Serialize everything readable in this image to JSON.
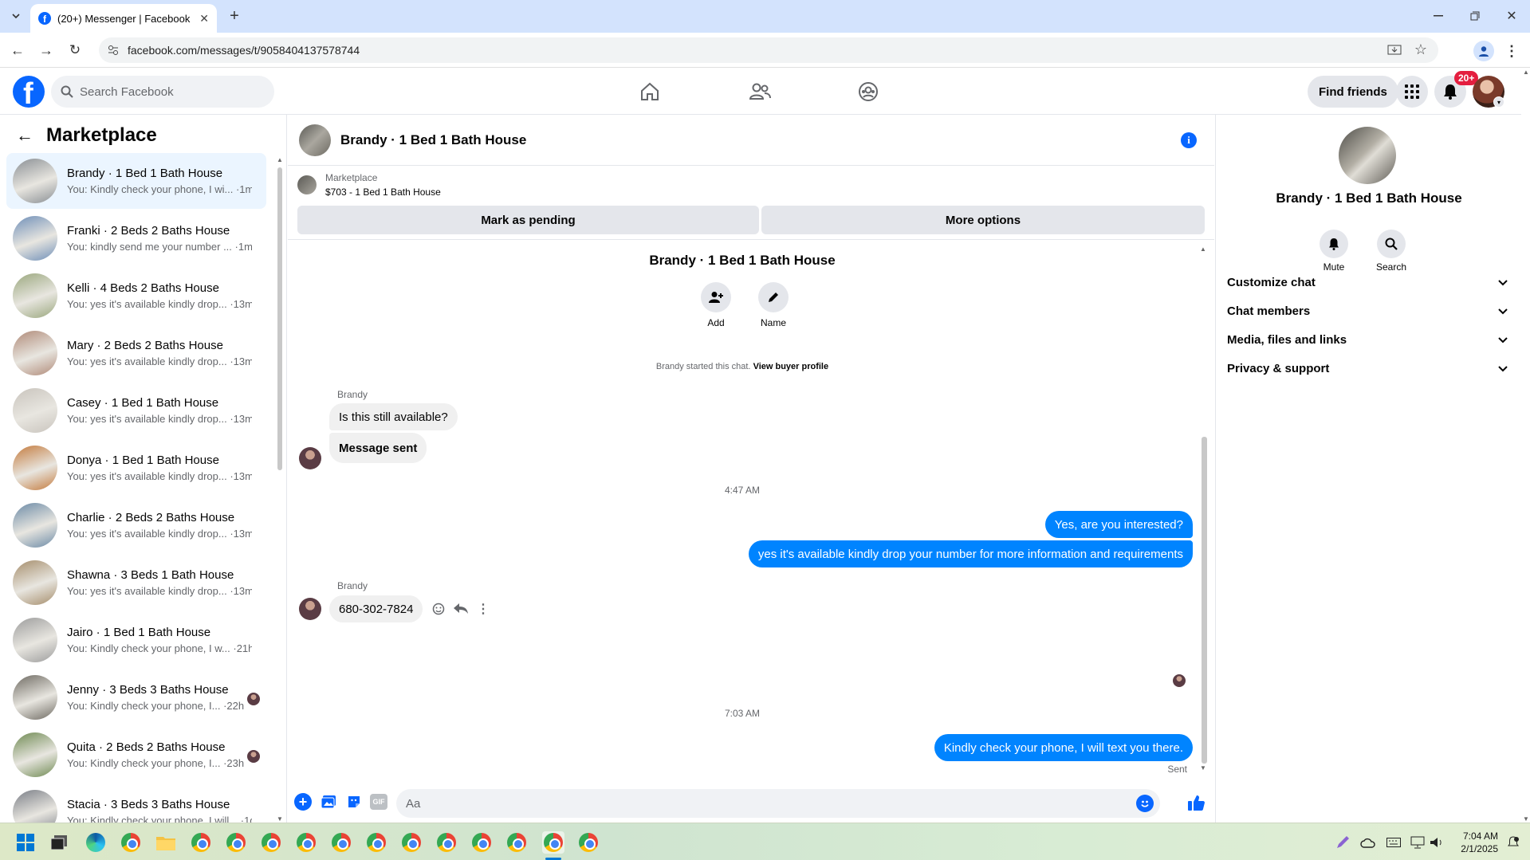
{
  "browser": {
    "tab_title": "(20+) Messenger | Facebook",
    "url": "facebook.com/messages/t/9058404137578744"
  },
  "header": {
    "search_placeholder": "Search Facebook",
    "find_friends": "Find friends",
    "notification_badge": "20+"
  },
  "sidebar": {
    "title": "Marketplace",
    "conversations": [
      {
        "name": "Brandy · 1 Bed 1 Bath House",
        "snippet": "You: Kindly check your phone, I wi... ·1m",
        "active": true,
        "color": "#8a8f94"
      },
      {
        "name": "Franki · 2 Beds 2 Baths House",
        "snippet": "You: kindly send me your number ... ·1m",
        "color": "#6f8fb8"
      },
      {
        "name": "Kelli · 4 Beds 2 Baths House",
        "snippet": "You: yes it's available kindly drop... ·13m",
        "color": "#9aa77d"
      },
      {
        "name": "Mary · 2 Beds 2 Baths House",
        "snippet": "You: yes it's available kindly drop... ·13m",
        "color": "#b08a78"
      },
      {
        "name": "Casey · 1 Bed 1 Bath House",
        "snippet": "You: yes it's available kindly drop... ·13m",
        "color": "#c9c4bd"
      },
      {
        "name": "Donya · 1 Bed 1 Bath House",
        "snippet": "You: yes it's available kindly drop... ·13m",
        "color": "#c47b3d"
      },
      {
        "name": "Charlie · 2 Beds 2 Baths House",
        "snippet": "You: yes it's available kindly drop... ·13m",
        "color": "#6b8aa6"
      },
      {
        "name": "Shawna · 3 Beds 1 Bath House",
        "snippet": "You: yes it's available kindly drop... ·13m",
        "color": "#a58d6b"
      },
      {
        "name": "Jairo · 1 Bed 1 Bath House",
        "snippet": "You: Kindly check your phone, I w... ·21h",
        "color": "#9c9c9c"
      },
      {
        "name": "Jenny · 3 Beds 3 Baths House",
        "snippet": "You: Kindly check your phone, I... ·22h",
        "color": "#6e6a62",
        "reader": true
      },
      {
        "name": "Quita · 2 Beds 2 Baths House",
        "snippet": "You: Kindly check your phone, I... ·23h",
        "color": "#6f8a52",
        "reader": true
      },
      {
        "name": "Stacia · 3 Beds 3 Baths House",
        "snippet": "You: Kindly check your phone, I will... ·1d",
        "color": "#7a7e86"
      }
    ]
  },
  "chat": {
    "title": "Brandy · 1 Bed 1 Bath House",
    "marketplace_label": "Marketplace",
    "listing": "$703 - 1 Bed 1 Bath House",
    "mark_pending": "Mark as pending",
    "more_options": "More options",
    "intro_name": "Brandy · 1 Bed 1 Bath House",
    "add_label": "Add",
    "name_label": "Name",
    "started_text": "Brandy started this chat.",
    "view_profile": "View buyer profile",
    "sender_name": "Brandy",
    "msg1": "Is this still available?",
    "msg2": "Message sent",
    "time1": "4:47 AM",
    "out1": "Yes, are you interested?",
    "out2": "yes it's available kindly drop your number for more information and requirements",
    "sender_name2": "Brandy",
    "phone_msg": "680-302-7824",
    "time2": "7:03 AM",
    "out3": "Kindly check your phone, I will text you there.",
    "sent_status": "Sent",
    "composer_placeholder": "Aa"
  },
  "details": {
    "title": "Brandy · 1 Bed 1 Bath House",
    "mute": "Mute",
    "search": "Search",
    "sections": [
      "Customize chat",
      "Chat members",
      "Media, files and links",
      "Privacy & support"
    ]
  },
  "taskbar": {
    "time": "7:04 AM",
    "date": "2/1/2025"
  },
  "colors": {
    "fb_blue": "#0866ff",
    "messenger_blue": "#0084ff",
    "badge_red": "#e41e3f"
  }
}
